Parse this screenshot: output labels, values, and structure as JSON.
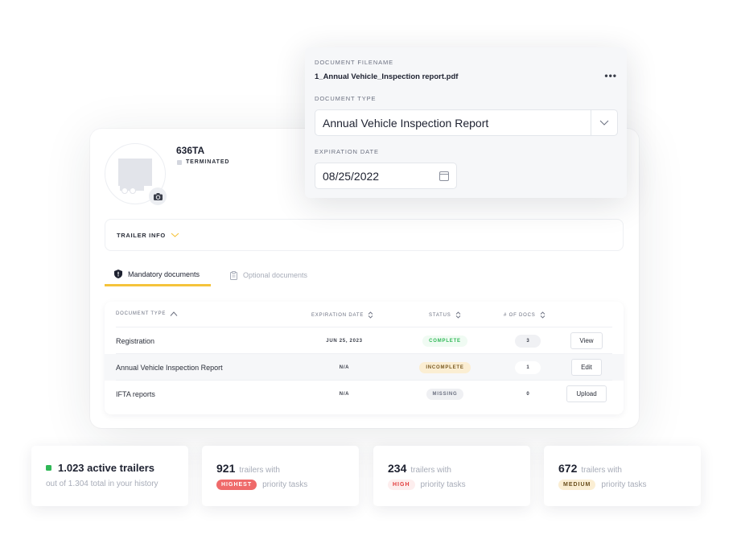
{
  "trailer": {
    "id": "636TA",
    "status": "TERMINATED",
    "info_label": "TRAILER INFO"
  },
  "tabs": [
    {
      "label": "Mandatory documents",
      "icon": "shield-icon",
      "active": true
    },
    {
      "label": "Optional documents",
      "icon": "clipboard-icon",
      "active": false
    }
  ],
  "table": {
    "columns": [
      "DOCUMENT TYPE",
      "EXPIRATION DATE",
      "STATUS",
      "# OF DOCS"
    ],
    "rows": [
      {
        "type": "Registration",
        "expiration": "JUN 25, 2023",
        "status": "COMPLETE",
        "docs": "3",
        "action": "View"
      },
      {
        "type": "Annual Vehicle Inspection Report",
        "expiration": "N/A",
        "status": "INCOMPLETE",
        "docs": "1",
        "action": "Edit"
      },
      {
        "type": "IFTA reports",
        "expiration": "N/A",
        "status": "MISSING",
        "docs": "0",
        "action": "Upload"
      }
    ]
  },
  "popup": {
    "filename_label": "DOCUMENT FILENAME",
    "filename": "1_Annual Vehicle_Inspection report.pdf",
    "more": "•••",
    "type_label": "DOCUMENT TYPE",
    "type_value": "Annual Vehicle Inspection Report",
    "expiration_label": "EXPIRATION DATE",
    "expiration_value": "08/25/2022"
  },
  "stats": [
    {
      "number": "1.023 active trailers",
      "subtitle": "out of 1.304 total in your history"
    },
    {
      "number": "921",
      "suffix": "trailers with",
      "badge": "HIGHEST",
      "tail": "priority tasks"
    },
    {
      "number": "234",
      "suffix": "trailers with",
      "badge": "HIGH",
      "tail": "priority tasks"
    },
    {
      "number": "672",
      "suffix": "trailers with",
      "badge": "MEDIUM",
      "tail": "priority tasks"
    }
  ],
  "colors": {
    "accent": "#f5c33b",
    "complete": "#2fb856",
    "incomplete_bg": "#fbeed3",
    "highest": "#ef6a6a",
    "high": "#e23b3b"
  }
}
